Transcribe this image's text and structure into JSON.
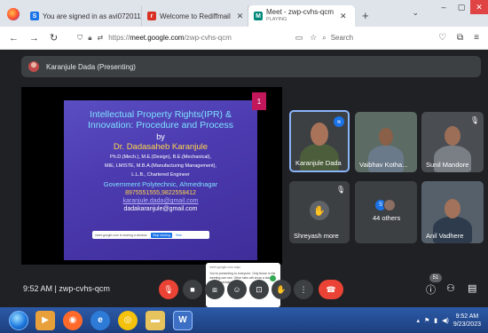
{
  "browser": {
    "tabs": [
      {
        "title": "You are signed in as avi0720111",
        "favicon": "S",
        "favicon_color": "#1a73e8"
      },
      {
        "title": "Welcome to Rediffmail",
        "favicon": "r",
        "favicon_color": "#d93025"
      },
      {
        "title": "Meet - zwp-cvhs-qcm",
        "subtitle": "PLAYING",
        "favicon": "M",
        "favicon_color": "#00897b",
        "active": true
      }
    ],
    "url_prefix": "https://",
    "url_domain": "meet.google.com",
    "url_path": "/zwp-cvhs-qcm",
    "search_placeholder": "Search"
  },
  "meet": {
    "presenter_label": "Karanjule Dada (Presenting)",
    "slide": {
      "number": "1",
      "title_line1": "Intellectual Property Rights(IPR) &",
      "title_line2": "Innovation: Procedure and Process",
      "by": "by",
      "author": "Dr. Dadasaheb Karanjule",
      "quals_line1": "Ph.D.(Mech.), M.E.(Design), B.E.(Mechanical),",
      "quals_line2": "MIE, LMISTE, M.B.A.(Manufacturing Management),",
      "quals_line3": "L.L.B., Chartered Engineer",
      "college": "Government Polytechnic, Ahmednagar",
      "phones": "8975551555,9822558412",
      "email1": "karanjule.dada@gmail.com",
      "email2": "dadakaranjule@gmail.com"
    },
    "share_banner": {
      "text": "meet.google.com is sharing a window.",
      "stop": "Stop sharing",
      "hide": "Hide"
    },
    "popup": {
      "header": "meet.google.com says",
      "body": "You're presenting to everyone. Only those in the meeting can see. Other tabs will show a tab of your presentation."
    },
    "participants": [
      {
        "name": "Karanjule Dada",
        "state": "speaking"
      },
      {
        "name": "Vaibhav Kotha...",
        "state": "none"
      },
      {
        "name": "Sunil Mandore",
        "state": "muted"
      },
      {
        "name": "Shreyash more",
        "state": "muted",
        "avatar": "hand"
      },
      {
        "name": "44 others",
        "state": "none"
      },
      {
        "name": "Anil Vadhere",
        "state": "none"
      }
    ],
    "time": "9:52 AM",
    "separator": "|",
    "meeting_code": "zwp-cvhs-qcm",
    "participant_count": "51"
  },
  "taskbar": {
    "time": "9:52 AM",
    "date": "9/23/2023"
  }
}
